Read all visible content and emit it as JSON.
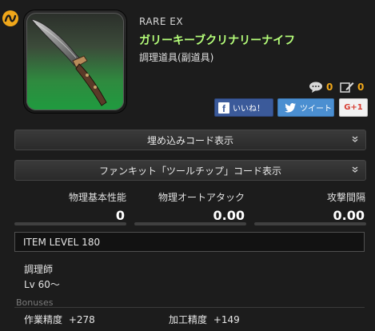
{
  "item": {
    "rarity": "RARE  EX",
    "name": "ガリーキーブクリナリーナイフ",
    "category": "調理道具(副道具)"
  },
  "counters": {
    "comments": "0",
    "reviews": "0"
  },
  "social": {
    "facebook": "いいね！",
    "twitter": "ツイート",
    "gplus": "G+1"
  },
  "bars": {
    "embed_code": "埋め込みコード表示",
    "fankit_code": "ファンキット「ツールチップ」コード表示"
  },
  "stats": [
    {
      "label": "物理基本性能",
      "value": "0"
    },
    {
      "label": "物理オートアタック",
      "value": "0.00"
    },
    {
      "label": "攻撃間隔",
      "value": "0.00"
    }
  ],
  "item_level": "ITEM LEVEL 180",
  "job": {
    "name": "調理師",
    "level": "Lv 60～"
  },
  "bonuses": {
    "title": "Bonuses",
    "items": [
      {
        "name": "作業精度",
        "value": "+278"
      },
      {
        "name": "加工精度",
        "value": "+149"
      }
    ]
  },
  "colors": {
    "item_name": "#b6ff7a",
    "counter": "#f0a71a",
    "facebook": "#3b5a9a",
    "twitter": "#4b8fd1"
  }
}
